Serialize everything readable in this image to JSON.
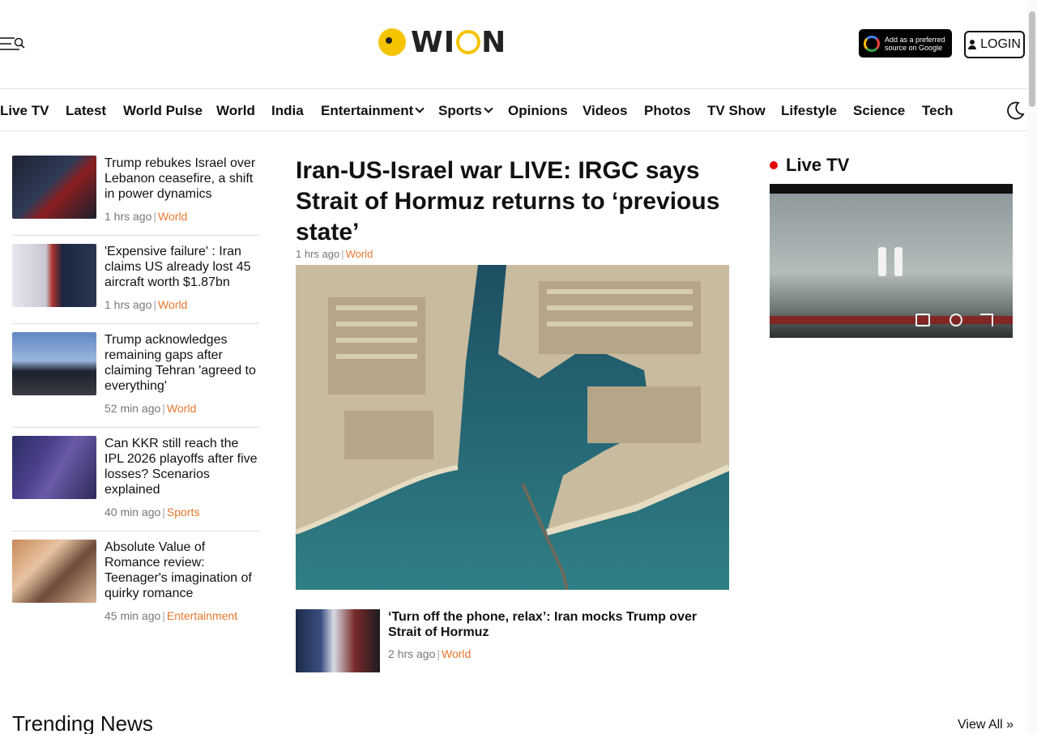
{
  "brand": {
    "name": "WION",
    "accent": "#f5c400",
    "category_color": "#e8762d"
  },
  "header": {
    "google_badge": "Add as a preferred source on Google",
    "login_label": "LOGIN"
  },
  "nav": [
    {
      "label": "Live TV"
    },
    {
      "label": "Latest"
    },
    {
      "label": "World Pulse"
    },
    {
      "label": "World"
    },
    {
      "label": "India"
    },
    {
      "label": "Entertainment",
      "dropdown": true
    },
    {
      "label": "Sports",
      "dropdown": true
    },
    {
      "label": "Opinions"
    },
    {
      "label": "Videos"
    },
    {
      "label": "Photos"
    },
    {
      "label": "TV Show"
    },
    {
      "label": "Lifestyle"
    },
    {
      "label": "Science"
    },
    {
      "label": "Tech"
    }
  ],
  "left_stories": [
    {
      "title": "Trump rebukes Israel over Lebanon ceasefire, a shift in power dynamics",
      "time": "1 hrs ago",
      "category": "World"
    },
    {
      "title": "'Expensive failure' : Iran claims US already lost 45 aircraft worth $1.87bn",
      "time": "1 hrs ago",
      "category": "World"
    },
    {
      "title": "Trump acknowledges remaining gaps after claiming Tehran 'agreed to everything'",
      "time": "52 min ago",
      "category": "World"
    },
    {
      "title": "Can KKR still reach the IPL 2026 playoffs after five losses? Scenarios explained",
      "time": "40 min ago",
      "category": "Sports"
    },
    {
      "title": "Absolute Value of Romance review: Teenager's imagination of quirky romance",
      "time": "45 min ago",
      "category": "Entertainment"
    }
  ],
  "main_story": {
    "title": "Iran-US-Israel war LIVE: IRGC says Strait of Hormuz returns to ‘previous state’",
    "time": "1 hrs ago",
    "category": "World"
  },
  "secondary_story": {
    "title": "‘Turn off the phone, relax’: Iran mocks Trump over Strait of Hormuz",
    "time": "2 hrs ago",
    "category": "World"
  },
  "live_tv": {
    "label": "Live TV"
  },
  "trending": {
    "title": "Trending News",
    "view_all": "View All »"
  }
}
